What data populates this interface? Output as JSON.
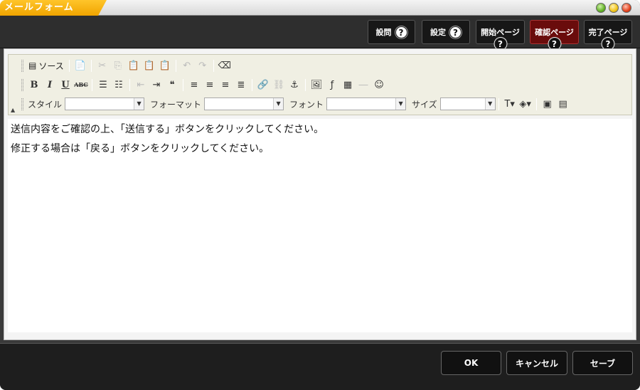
{
  "window": {
    "title": "メールフォーム"
  },
  "top_buttons": [
    {
      "label": "設問",
      "help": "?"
    },
    {
      "label": "設定",
      "help": "?"
    },
    {
      "label": "開始ページ",
      "help": "?"
    },
    {
      "label": "確認ページ",
      "help": "?",
      "active": true
    },
    {
      "label": "完了ページ",
      "help": "?"
    }
  ],
  "toolbar": {
    "source_label": "ソース",
    "bold": "B",
    "italic": "I",
    "underline": "U",
    "strike": "ABC",
    "style_label": "スタイル",
    "format_label": "フォーマット",
    "font_label": "フォント",
    "size_label": "サイズ",
    "style_value": "",
    "format_value": "",
    "font_value": "",
    "size_value": ""
  },
  "content": {
    "lines": [
      "送信内容をご確認の上、「送信する」ボタンをクリックしてください。",
      "修正する場合は「戻る」ボタンをクリックしてください。"
    ]
  },
  "bottom_buttons": {
    "ok": "OK",
    "cancel": "キャンセル",
    "save": "セーブ"
  },
  "colors": {
    "title_tab": "#f5b000",
    "active_tab": "#6a0c0c",
    "toolbar_bg": "#f0efe3"
  }
}
